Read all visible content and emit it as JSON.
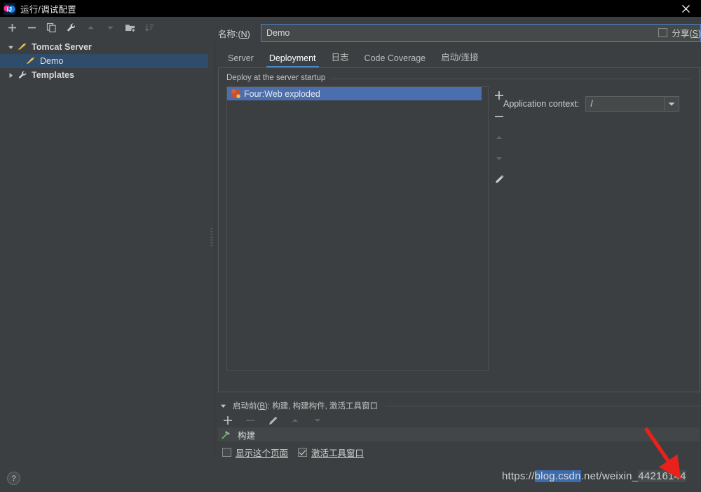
{
  "window": {
    "title": "运行/调试配置",
    "logo_icon": "intellij-idea-logo-icon",
    "close_icon": "close-icon"
  },
  "toolbar": {
    "buttons": [
      {
        "name": "add-configuration-button",
        "icon": "plus-icon",
        "enabled": true
      },
      {
        "name": "remove-configuration-button",
        "icon": "minus-icon",
        "enabled": true
      },
      {
        "name": "copy-configuration-button",
        "icon": "copy-icon",
        "enabled": true
      },
      {
        "name": "edit-templates-button",
        "icon": "wrench-icon",
        "enabled": true
      },
      {
        "name": "move-up-button",
        "icon": "arrow-up-icon",
        "enabled": false
      },
      {
        "name": "move-down-button",
        "icon": "arrow-down-icon",
        "enabled": false
      },
      {
        "name": "move-into-folder-button",
        "icon": "folder-add-icon",
        "enabled": true
      },
      {
        "name": "sort-configurations-button",
        "icon": "sort-icon",
        "enabled": false
      }
    ]
  },
  "tree": {
    "items": [
      {
        "label": "Tomcat Server",
        "icon": "tomcat-icon",
        "twisty": "expanded",
        "level": 1,
        "selected": false
      },
      {
        "label": "Demo",
        "icon": "tomcat-icon",
        "twisty": "none",
        "level": 2,
        "selected": true
      },
      {
        "label": "Templates",
        "icon": "wrench-icon",
        "twisty": "collapsed",
        "level": 1,
        "selected": false
      }
    ]
  },
  "name_row": {
    "label_prefix": "名称:(",
    "label_mnemonic": "N",
    "label_suffix": ")",
    "value": "Demo",
    "placeholder": ""
  },
  "share": {
    "label_prefix": "分享(",
    "label_mnemonic": "S",
    "label_suffix": ")",
    "checked": false
  },
  "tabs": [
    {
      "label": "Server",
      "active": false
    },
    {
      "label": "Deployment",
      "active": true
    },
    {
      "label": "日志",
      "active": false
    },
    {
      "label": "Code Coverage",
      "active": false
    },
    {
      "label": "启动/连接",
      "active": false
    }
  ],
  "deployment": {
    "legend": "Deploy at the server startup",
    "artifacts": [
      {
        "label": "Four:Web exploded",
        "icon": "artifact-icon",
        "selected": true
      }
    ],
    "vertical_toolbar": [
      {
        "name": "add-artifact-button",
        "icon": "plus-icon",
        "enabled": true
      },
      {
        "name": "remove-artifact-button",
        "icon": "minus-icon",
        "enabled": true
      },
      {
        "name": "move-artifact-up-button",
        "icon": "arrow-up-icon",
        "enabled": false
      },
      {
        "name": "move-artifact-down-button",
        "icon": "arrow-down-icon",
        "enabled": false
      },
      {
        "name": "edit-artifact-button",
        "icon": "pencil-icon",
        "enabled": true
      }
    ],
    "application_context": {
      "label": "Application context:",
      "value": "/",
      "dropdown_icon": "chevron-down-icon"
    }
  },
  "before_launch": {
    "title_prefix": "启动前(",
    "title_mnemonic": "B",
    "title_suffix": "): 构建, 构建构件, 激活工具窗口",
    "twisty": "expanded",
    "toolbar": [
      {
        "name": "add-task-button",
        "icon": "plus-icon",
        "enabled": true
      },
      {
        "name": "remove-task-button",
        "icon": "minus-icon",
        "enabled": false
      },
      {
        "name": "edit-task-button",
        "icon": "pencil-icon",
        "enabled": true
      },
      {
        "name": "task-move-up-button",
        "icon": "arrow-up-icon",
        "enabled": false
      },
      {
        "name": "task-move-down-button",
        "icon": "arrow-down-icon",
        "enabled": false
      }
    ],
    "tasks": [
      {
        "label": "构建",
        "icon": "build-hammer-icon"
      }
    ],
    "checkboxes": [
      {
        "label": "显示这个页面",
        "checked": false,
        "name": "show-this-page-checkbox"
      },
      {
        "label": "激活工具窗口",
        "checked": true,
        "name": "activate-tool-window-checkbox"
      }
    ]
  },
  "footer": {
    "help_label": "?"
  },
  "watermark": {
    "part1": "https://",
    "part2": "blog.",
    "part3": "csdn",
    "part4": ".net/weixin_",
    "part5": "44216144"
  },
  "annotation": {
    "arrow_color": "#e8211b",
    "arrow_name": "red-pointer-arrow"
  },
  "colors": {
    "accent": "#4a88c7",
    "selection": "#4b6eaf",
    "tree_selection": "#2f4c6b",
    "panel_bg": "#3c3f41",
    "titlebar_bg": "#000000",
    "input_bg": "#45494a",
    "text": "#d6d6d6"
  }
}
